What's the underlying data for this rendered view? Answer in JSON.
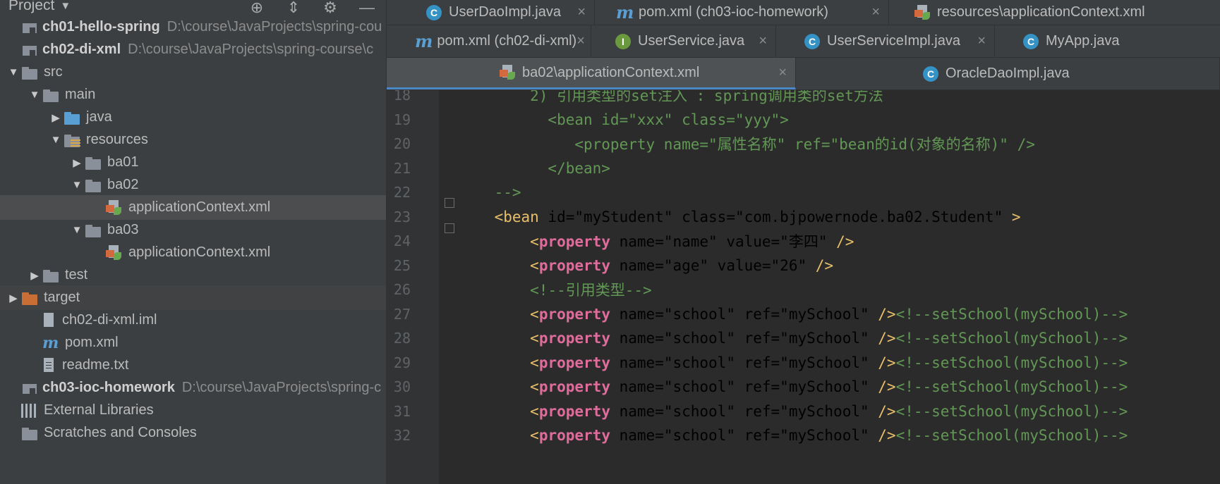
{
  "project_panel": {
    "title": "Project",
    "tree": [
      {
        "indent": 0,
        "arrow": "",
        "icon": "module",
        "name": "ch01-hello-spring",
        "bold": true,
        "path": "D:\\course\\JavaProjects\\spring-cou"
      },
      {
        "indent": 0,
        "arrow": "",
        "icon": "module",
        "name": "ch02-di-xml",
        "bold": true,
        "path": "D:\\course\\JavaProjects\\spring-course\\c"
      },
      {
        "indent": 0,
        "arrow": "▼",
        "icon": "folder",
        "name": "src"
      },
      {
        "indent": 1,
        "arrow": "▼",
        "icon": "folder",
        "name": "main"
      },
      {
        "indent": 2,
        "arrow": "▶",
        "icon": "folder-blue",
        "name": "java"
      },
      {
        "indent": 2,
        "arrow": "▼",
        "icon": "folder-res",
        "name": "resources"
      },
      {
        "indent": 3,
        "arrow": "▶",
        "icon": "folder",
        "name": "ba01"
      },
      {
        "indent": 3,
        "arrow": "▼",
        "icon": "folder",
        "name": "ba02"
      },
      {
        "indent": 4,
        "arrow": "",
        "icon": "xml",
        "name": "applicationContext.xml",
        "selected": true
      },
      {
        "indent": 3,
        "arrow": "▼",
        "icon": "folder",
        "name": "ba03"
      },
      {
        "indent": 4,
        "arrow": "",
        "icon": "xml",
        "name": "applicationContext.xml"
      },
      {
        "indent": 1,
        "arrow": "▶",
        "icon": "folder",
        "name": "test"
      },
      {
        "indent": 0,
        "arrow": "▶",
        "icon": "folder-orange",
        "name": "target",
        "striped": true
      },
      {
        "indent": 1,
        "arrow": "",
        "icon": "file",
        "name": "ch02-di-xml.iml"
      },
      {
        "indent": 1,
        "arrow": "",
        "icon": "maven",
        "name": "pom.xml"
      },
      {
        "indent": 1,
        "arrow": "",
        "icon": "txt",
        "name": "readme.txt"
      },
      {
        "indent": 0,
        "arrow": "",
        "icon": "module",
        "name": "ch03-ioc-homework",
        "bold": true,
        "path": "D:\\course\\JavaProjects\\spring-c"
      },
      {
        "indent": 0,
        "arrow": "",
        "icon": "lib",
        "name": "External Libraries"
      },
      {
        "indent": 0,
        "arrow": "",
        "icon": "folder",
        "name": "Scratches and Consoles"
      }
    ]
  },
  "tabs_row1": [
    {
      "label": "UserDaoImpl.java",
      "icon": "C"
    },
    {
      "label": "pom.xml (ch03-ioc-homework)",
      "icon": "m"
    },
    {
      "label": "resources\\applicationContext.xml",
      "icon": "xml"
    }
  ],
  "tabs_row2": [
    {
      "label": "pom.xml (ch02-di-xml)",
      "icon": "m"
    },
    {
      "label": "UserService.java",
      "icon": "I"
    },
    {
      "label": "UserServiceImpl.java",
      "icon": "C"
    },
    {
      "label": "MyApp.java",
      "icon": "C"
    }
  ],
  "tabs_row3": [
    {
      "label": "ba02\\applicationContext.xml",
      "icon": "xml",
      "active": true
    },
    {
      "label": "OracleDaoImpl.java",
      "icon": "C"
    }
  ],
  "editor": {
    "lines": [
      {
        "n": "18",
        "text": "        2) 引用类型的set注入 : spring调用类的set方法"
      },
      {
        "n": "19",
        "text": "          <bean id=\"xxx\" class=\"yyy\">"
      },
      {
        "n": "20",
        "text": "             <property name=\"属性名称\" ref=\"bean的id(对象的名称)\" />"
      },
      {
        "n": "21",
        "text": "          </bean>"
      },
      {
        "n": "22",
        "text": "    -->"
      },
      {
        "n": "23",
        "text": "    <bean id=\"myStudent\" class=\"com.bjpowernode.ba02.Student\" >"
      },
      {
        "n": "24",
        "text": "        <property name=\"name\" value=\"李四\" />"
      },
      {
        "n": "25",
        "text": "        <property name=\"age\" value=\"26\" />"
      },
      {
        "n": "26",
        "text": "        <!--引用类型-->"
      },
      {
        "n": "27",
        "text": "        <property name=\"school\" ref=\"mySchool\" /><!--setSchool(mySchool)-->"
      },
      {
        "n": "28",
        "text": "        <property name=\"school\" ref=\"mySchool\" /><!--setSchool(mySchool)-->"
      },
      {
        "n": "29",
        "text": "        <property name=\"school\" ref=\"mySchool\" /><!--setSchool(mySchool)-->"
      },
      {
        "n": "30",
        "text": "        <property name=\"school\" ref=\"mySchool\" /><!--setSchool(mySchool)-->"
      },
      {
        "n": "31",
        "text": "        <property name=\"school\" ref=\"mySchool\" /><!--setSchool(mySchool)-->"
      },
      {
        "n": "32",
        "text": "        <property name=\"school\" ref=\"mySchool\" /><!--setSchool(mySchool)-->"
      }
    ]
  },
  "colors": {
    "panel_bg": "#3c3f41",
    "editor_bg": "#2b2b2b",
    "tag": "#e8bf6a",
    "value": "#6a8759",
    "comment": "#629755",
    "keyword_property": "#e06c9c",
    "accent_tab": "#4a88c7"
  }
}
